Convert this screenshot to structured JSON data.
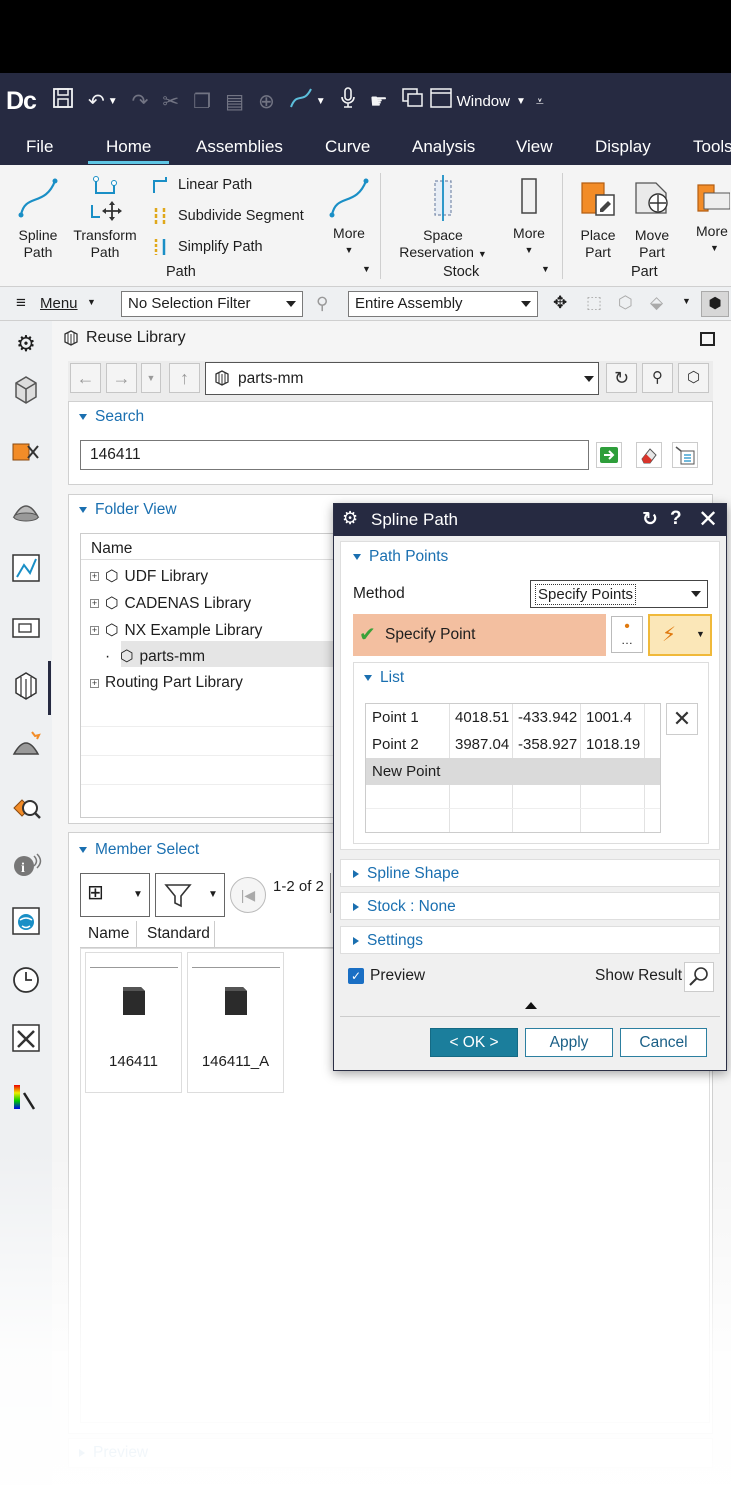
{
  "app": {
    "logo": "Dc",
    "window_menu": "Window"
  },
  "menu_tabs": [
    "File",
    "Home",
    "Assemblies",
    "Curve",
    "Analysis",
    "View",
    "Display",
    "Tools"
  ],
  "ribbon": {
    "spline_path": [
      "Spline",
      "Path"
    ],
    "transform_path": [
      "Transform",
      "Path"
    ],
    "linear_path": "Linear Path",
    "subdivide_segment": "Subdivide Segment",
    "simplify_path": "Simplify Path",
    "more": "More",
    "group_path": "Path",
    "space_reservation": [
      "Space",
      "Reservation"
    ],
    "group_stock": "Stock",
    "place_part": [
      "Place",
      "Part"
    ],
    "move_part": [
      "Move",
      "Part"
    ],
    "group_part": "Part",
    "more_cut": "More"
  },
  "selection_bar": {
    "menu": "Menu",
    "filter": "No Selection Filter",
    "scope": "Entire Assembly"
  },
  "reuse": {
    "title": "Reuse Library",
    "path": "parts-mm",
    "search_label": "Search",
    "search_value": "146411",
    "folder_label": "Folder View",
    "name_col": "Name",
    "folders": [
      "UDF Library",
      "CADENAS Library",
      "NX Example Library",
      "parts-mm",
      "Routing Part Library"
    ],
    "member_label": "Member Select",
    "count": "1-2 of 2",
    "member_cols": [
      "Name",
      "Standard"
    ],
    "members": [
      "146411",
      "146411_A"
    ],
    "preview_label": "Preview"
  },
  "dialog": {
    "title": "Spline Path",
    "path_points": "Path Points",
    "method_label": "Method",
    "method_value": "Specify Points",
    "specify_point": "Specify Point",
    "list_label": "List",
    "points": [
      {
        "name": "Point 1",
        "x": "4018.51",
        "y": "-433.942",
        "z": "1001.4"
      },
      {
        "name": "Point 2",
        "x": "3987.04",
        "y": "-358.927",
        "z": "1018.19"
      },
      {
        "name": "New Point",
        "x": "",
        "y": "",
        "z": ""
      }
    ],
    "spline_shape": "Spline Shape",
    "stock": "Stock : None",
    "settings": "Settings",
    "preview": "Preview",
    "show_result": "Show Result",
    "ok": "< OK >",
    "apply": "Apply",
    "cancel": "Cancel"
  },
  "colors": {
    "title_bg": "#262a41",
    "accent": "#5fc6e4",
    "link_blue": "#1a6fb0",
    "ok_bg": "#1b7e9c",
    "specify_bg": "#f3bfa0"
  }
}
